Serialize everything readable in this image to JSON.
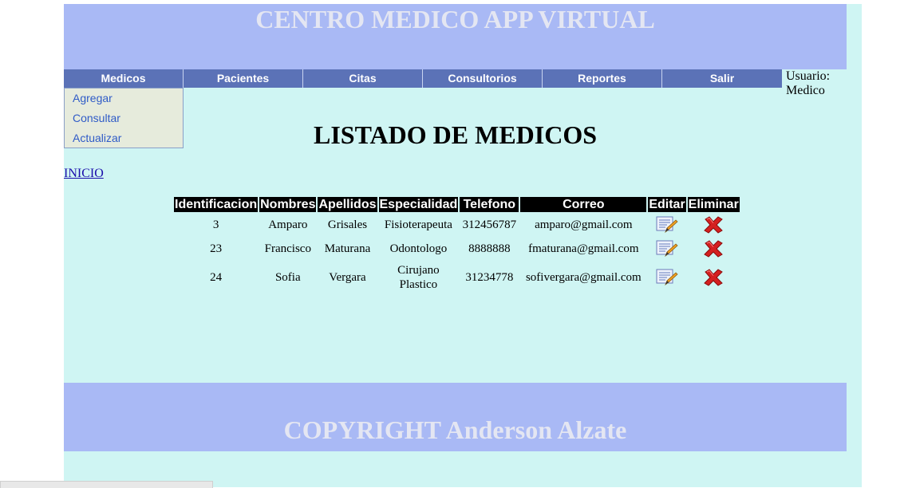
{
  "header": {
    "title": "CENTRO MEDICO APP VIRTUAL"
  },
  "nav": [
    {
      "label": "Medicos"
    },
    {
      "label": "Pacientes"
    },
    {
      "label": "Citas"
    },
    {
      "label": "Consultorios"
    },
    {
      "label": "Reportes"
    },
    {
      "label": "Salir"
    }
  ],
  "user": {
    "label": "Usuario:",
    "name": "Medico"
  },
  "dropdown": [
    {
      "label": "Agregar"
    },
    {
      "label": "Consultar"
    },
    {
      "label": "Actualizar"
    }
  ],
  "main": {
    "title": "LISTADO DE MEDICOS",
    "home_link": "INICIO"
  },
  "table": {
    "headers": [
      "Identificacion",
      "Nombres",
      "Apellidos",
      "Especialidad",
      "Telefono",
      "Correo",
      "Editar",
      "Eliminar"
    ],
    "rows": [
      {
        "id": "3",
        "nombres": "Amparo",
        "apellidos": "Grisales",
        "especialidad": "Fisioterapeuta",
        "telefono": "312456787",
        "correo": "amparo@gmail.com"
      },
      {
        "id": "23",
        "nombres": "Francisco",
        "apellidos": "Maturana",
        "especialidad": "Odontologo",
        "telefono": "8888888",
        "correo": "fmaturana@gmail.com"
      },
      {
        "id": "24",
        "nombres": "Sofia",
        "apellidos": "Vergara",
        "especialidad": "Cirujano Plastico",
        "telefono": "31234778",
        "correo": "sofivergara@gmail.com"
      }
    ],
    "icons": {
      "edit": "edit-document-icon",
      "delete": "red-x-delete-icon"
    }
  },
  "footer": {
    "copyright": "COPYRIGHT Anderson Alzate"
  },
  "colors": {
    "page_bg": "#cff5f3",
    "header_bg": "#a9b9f5",
    "nav_bg": "#5b72b7",
    "delete_red": "#d42020"
  }
}
